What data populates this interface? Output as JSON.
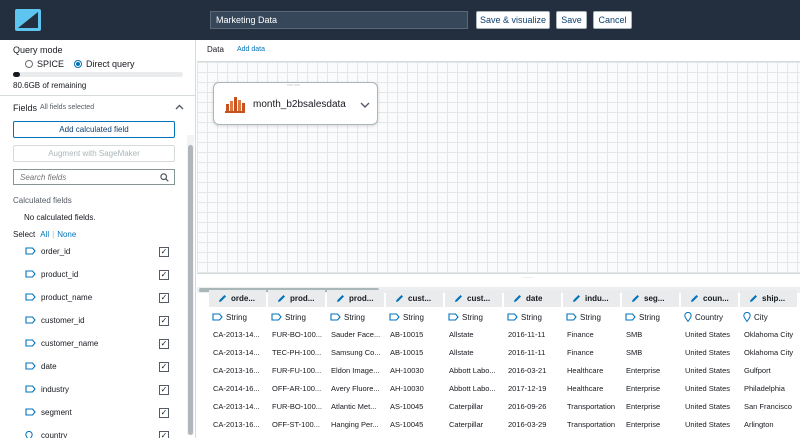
{
  "header": {
    "title_value": "Marketing Data",
    "save_visualize_label": "Save & visualize",
    "save_label": "Save",
    "cancel_label": "Cancel"
  },
  "query_mode": {
    "title": "Query mode",
    "spice_label": "SPICE",
    "direct_label": "Direct query",
    "selected": "Direct query",
    "capacity_used_fraction": 0.04,
    "capacity_text": "80.6GB of remaining"
  },
  "fields": {
    "title": "Fields",
    "subtitle": "All fields selected",
    "add_calc_label": "Add calculated field",
    "augment_label": "Augment with SageMaker",
    "search_placeholder": "Search fields",
    "calc_section_label": "Calculated fields",
    "no_calc_text": "No calculated fields.",
    "select_label": "Select",
    "select_all": "All",
    "select_sep": "|",
    "select_none": "None",
    "items": [
      {
        "name": "order_id",
        "icon": "string-tag-icon"
      },
      {
        "name": "product_id",
        "icon": "string-tag-icon"
      },
      {
        "name": "product_name",
        "icon": "string-tag-icon"
      },
      {
        "name": "customer_id",
        "icon": "string-tag-icon"
      },
      {
        "name": "customer_name",
        "icon": "string-tag-icon"
      },
      {
        "name": "date",
        "icon": "string-tag-icon"
      },
      {
        "name": "industry",
        "icon": "string-tag-icon"
      },
      {
        "name": "segment",
        "icon": "string-tag-icon"
      },
      {
        "name": "country",
        "icon": "location-pin-icon"
      }
    ]
  },
  "data_panel": {
    "tab_label": "Data",
    "add_data_label": "Add data",
    "source_name": "month_b2bsalesdata"
  },
  "table": {
    "columns": [
      {
        "header": "orde...",
        "type": "String",
        "type_icon": "string-tag-icon"
      },
      {
        "header": "prod...",
        "type": "String",
        "type_icon": "string-tag-icon"
      },
      {
        "header": "prod...",
        "type": "String",
        "type_icon": "string-tag-icon"
      },
      {
        "header": "cust...",
        "type": "String",
        "type_icon": "string-tag-icon"
      },
      {
        "header": "cust...",
        "type": "String",
        "type_icon": "string-tag-icon"
      },
      {
        "header": "date",
        "type": "String",
        "type_icon": "string-tag-icon"
      },
      {
        "header": "indu...",
        "type": "String",
        "type_icon": "string-tag-icon"
      },
      {
        "header": "seg...",
        "type": "String",
        "type_icon": "string-tag-icon"
      },
      {
        "header": "coun...",
        "type": "Country",
        "type_icon": "location-pin-icon"
      },
      {
        "header": "ship...",
        "type": "City",
        "type_icon": "location-pin-icon"
      }
    ],
    "rows": [
      [
        "CA-2013-14...",
        "FUR-BO-100...",
        "Sauder Face...",
        "AB-10015",
        "Allstate",
        "2016-11-11",
        "Finance",
        "SMB",
        "United States",
        "Oklahoma City"
      ],
      [
        "CA-2013-14...",
        "TEC-PH-100...",
        "Samsung Co...",
        "AB-10015",
        "Allstate",
        "2016-11-11",
        "Finance",
        "SMB",
        "United States",
        "Oklahoma City"
      ],
      [
        "CA-2013-16...",
        "FUR-FU-100...",
        "Eldon Image...",
        "AH-10030",
        "Abbott Labo...",
        "2016-03-21",
        "Healthcare",
        "Enterprise",
        "United States",
        "Gulfport"
      ],
      [
        "CA-2014-16...",
        "OFF-AR-100...",
        "Avery Fluore...",
        "AH-10030",
        "Abbott Labo...",
        "2017-12-19",
        "Healthcare",
        "Enterprise",
        "United States",
        "Philadelphia"
      ],
      [
        "CA-2013-14...",
        "FUR-BO-100...",
        "Atlantic Met...",
        "AS-10045",
        "Caterpillar",
        "2016-09-26",
        "Transportation",
        "Enterprise",
        "United States",
        "San Francisco"
      ],
      [
        "CA-2013-16...",
        "OFF-ST-100...",
        "Hanging Per...",
        "AS-10045",
        "Caterpillar",
        "2016-03-29",
        "Transportation",
        "Enterprise",
        "United States",
        "Arlington"
      ]
    ]
  },
  "colors": {
    "header_bg": "#232f3e",
    "accent": "#0073bb",
    "logo_blue": "#5ec4f0"
  }
}
